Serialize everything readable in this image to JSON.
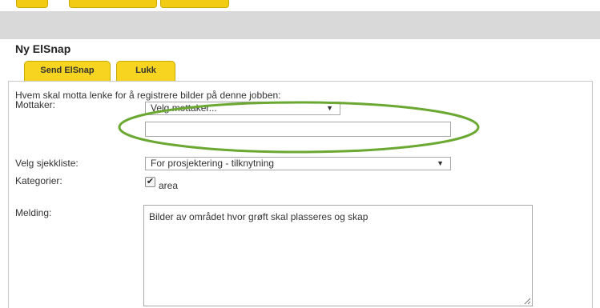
{
  "top_tabs": [
    "",
    "",
    ""
  ],
  "dialog": {
    "title": "Ny ElSnap",
    "tabs": [
      {
        "label": "Send ElSnap"
      },
      {
        "label": "Lukk"
      }
    ]
  },
  "form": {
    "question": "Hvem skal motta lenke for å registrere bilder på denne jobben:",
    "mottaker_label": "Mottaker:",
    "mottaker_select_value": "Velg mottaker...",
    "mottaker_input_value": "",
    "sjekkliste_label": "Velg sjekkliste:",
    "sjekkliste_value": "For prosjektering - tilknytning",
    "kategorier_label": "Kategorier:",
    "kategori_option": "area",
    "kategori_checked": true,
    "melding_label": "Melding:",
    "melding_value": "Bilder av området hvor grøft skal plasseres og skap"
  },
  "annotation": {
    "color": "#6aa832",
    "shape": "ellipse"
  },
  "icons": {
    "dropdown": "chevron-down-icon",
    "check": "check-icon",
    "resize": "resize-handle-icon"
  }
}
